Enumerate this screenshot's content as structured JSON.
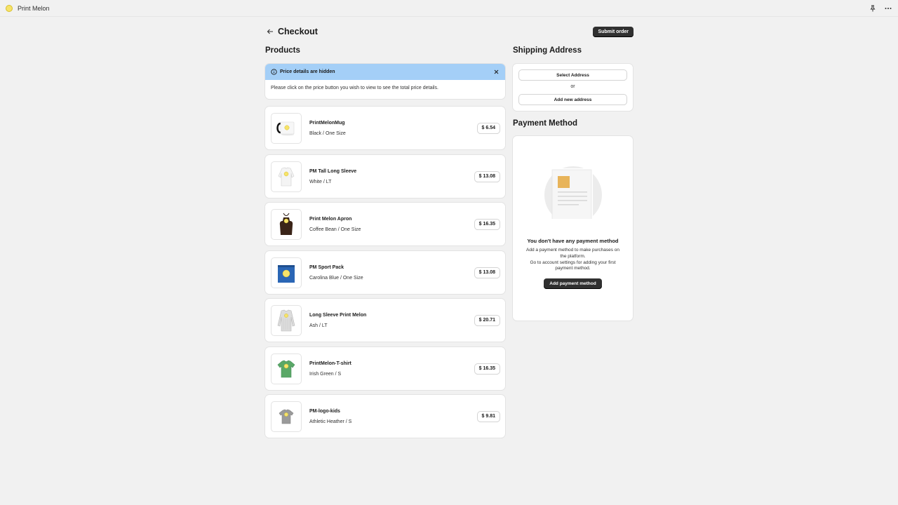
{
  "app": {
    "title": "Print Melon"
  },
  "header": {
    "title": "Checkout",
    "submit_label": "Submit order"
  },
  "products_section": {
    "title": "Products"
  },
  "banner": {
    "title": "Price details are hidden",
    "message": "Please click on the price button you wish to view to see the total price details."
  },
  "products": [
    {
      "name": "PrintMelonMug",
      "variant": "Black / One Size",
      "price": "$ 6.54"
    },
    {
      "name": "PM Tall Long Sleeve",
      "variant": "White / LT",
      "price": "$ 13.08"
    },
    {
      "name": "Print Melon Apron",
      "variant": "Coffee Bean / One Size",
      "price": "$ 16.35"
    },
    {
      "name": "PM Sport Pack",
      "variant": "Carolina Blue / One Size",
      "price": "$ 13.08"
    },
    {
      "name": "Long Sleeve Print Melon",
      "variant": "Ash / LT",
      "price": "$ 20.71"
    },
    {
      "name": "PrintMelon-T-shirt",
      "variant": "Irish Green / S",
      "price": "$ 16.35"
    },
    {
      "name": "PM-logo-kids",
      "variant": "Athletic Heather / S",
      "price": "$ 9.81"
    }
  ],
  "shipping": {
    "title": "Shipping Address",
    "select_label": "Select Address",
    "or_label": "or",
    "add_label": "Add new address"
  },
  "payment": {
    "title": "Payment Method",
    "empty_title": "You don't have any payment method",
    "empty_line1": "Add a payment method to make purchases on",
    "empty_line2": "the platform.",
    "empty_line3": "Go to account settings for adding your first",
    "empty_line4": "payment method.",
    "add_label": "Add payment method"
  },
  "colors": {
    "banner_bg": "#a4cff7",
    "primary_button": "#303030",
    "logo_yellow": "#f6e36a"
  },
  "icons": {
    "app_logo": "melon-logo-icon",
    "pin": "pin-icon",
    "more": "more-horizontal-icon",
    "back": "arrow-left-icon",
    "info": "info-icon",
    "close": "close-icon"
  }
}
